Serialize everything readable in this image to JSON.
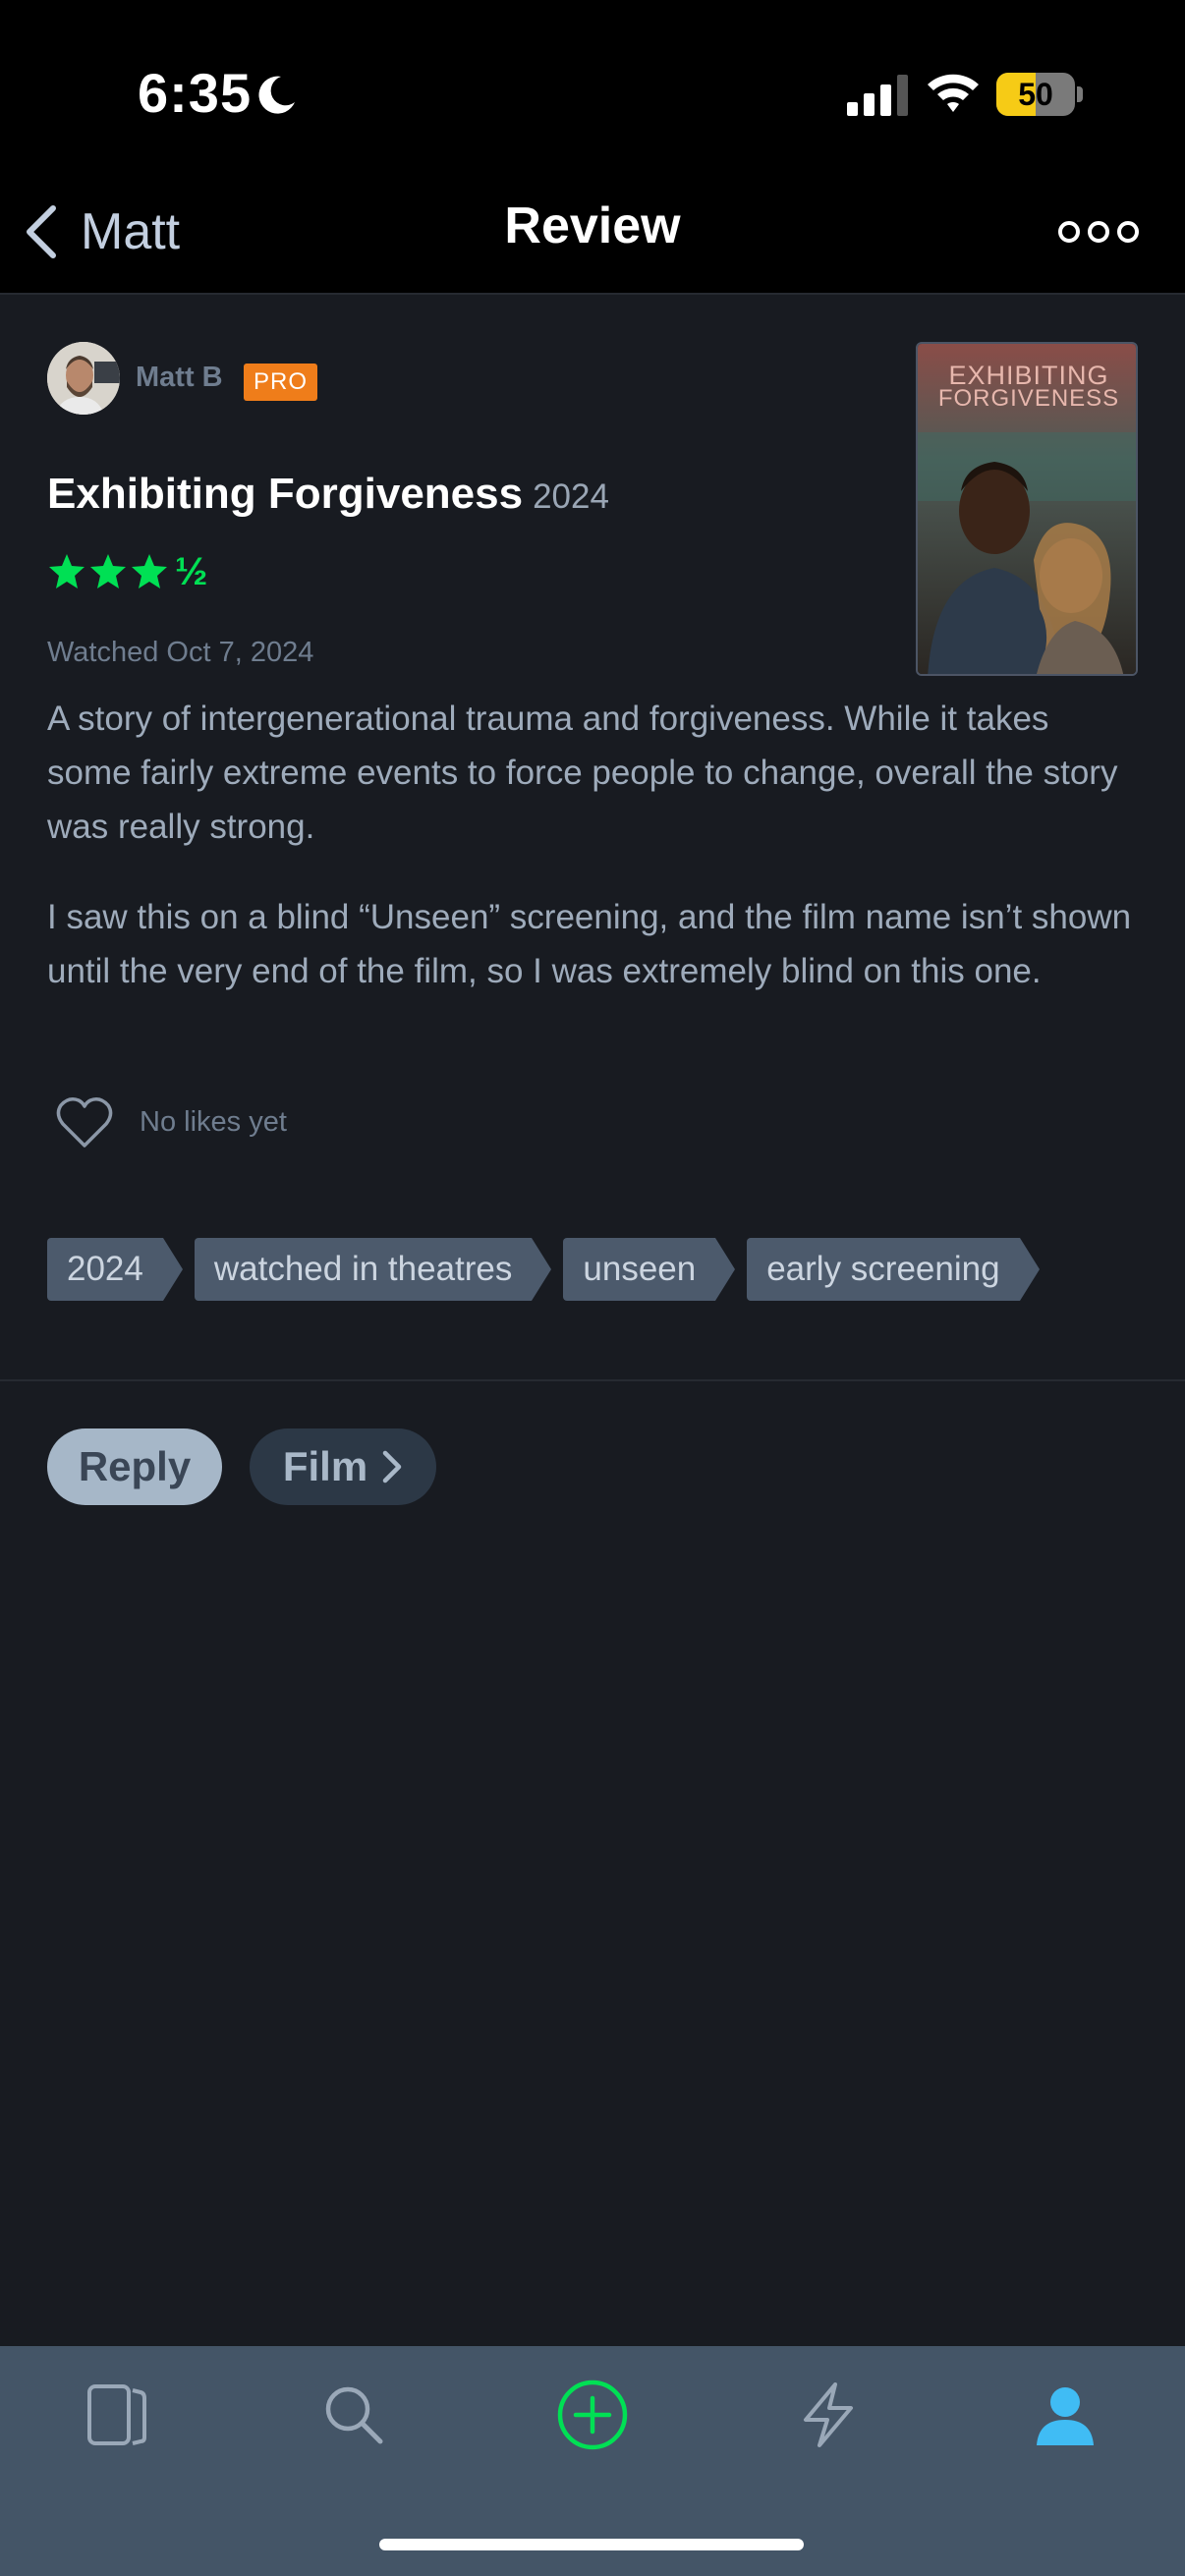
{
  "status_bar": {
    "time": "6:35",
    "battery": "50",
    "battery_level": 0.5,
    "icons": [
      "moon-icon",
      "signal-icon",
      "wifi-icon",
      "battery-icon"
    ]
  },
  "nav": {
    "back_label": "Matt",
    "title": "Review",
    "more_icon": "ellipsis-icon"
  },
  "review": {
    "author": "Matt B",
    "badge": "PRO",
    "film_title": "Exhibiting Forgiveness",
    "film_year": "2024",
    "rating": 3.5,
    "half_star": "½",
    "watched": "Watched Oct 7, 2024",
    "paragraphs": [
      "A story of intergenerational trauma and forgiveness. While it takes some fairly extreme events to force people to change, overall the story was really strong.",
      "I saw this on a blind “Unseen” screening, and the film name isn’t shown until the very end of the film, so I was extremely blind on this one."
    ],
    "likes_text": "No likes yet",
    "poster_text": [
      "EXHIBITING",
      "FORGIVENESS"
    ],
    "tags": [
      "2024",
      "watched in theatres",
      "unseen",
      "early screening"
    ]
  },
  "actions": {
    "reply": "Reply",
    "film": "Film"
  },
  "tabbar": {
    "tabs": [
      "films-icon",
      "search-icon",
      "add-icon",
      "activity-icon",
      "profile-icon"
    ]
  },
  "colors": {
    "star_green": "#00e054",
    "pro_orange": "#ef7d1a",
    "profile_blue": "#40bcf4",
    "background": "#181b21"
  }
}
